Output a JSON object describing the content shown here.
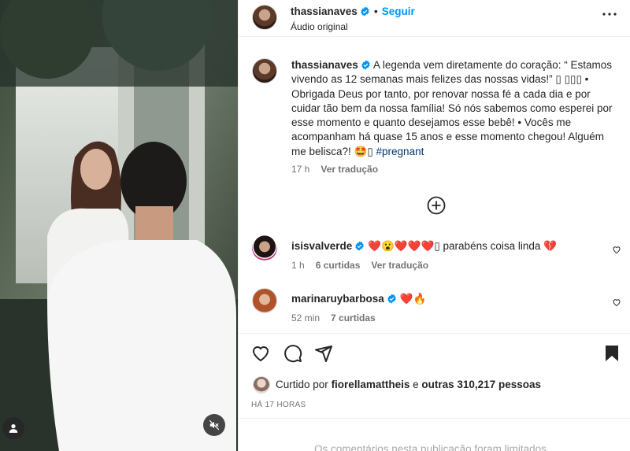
{
  "post": {
    "author": "thassianaves",
    "separator": "•",
    "follow_label": "Seguir",
    "audio_label": "Áudio original"
  },
  "caption": {
    "author": "thassianaves",
    "text_before_tag": "A legenda vem diretamente do coração: “ Estamos vivendo as 12 semanas mais felizes das nossas vidas!” ▯ ▯▯▯ • Obrigada Deus por tanto, por renovar nossa fé a cada dia e por cuidar tão bem da nossa família! Só nós sabemos como esperei por esse momento e quanto desejamos esse bebê! • Vocês me acompanham há quase 15 anos e esse momento chegou! Alguém me belisca?! 🤩▯ ",
    "hashtag": "#pregnant",
    "time": "17 h",
    "translate_label": "Ver tradução"
  },
  "comments": [
    {
      "username": "isisvalverde",
      "text": "❤️😮❤️❤️❤️▯ parabéns coisa linda 💔",
      "time": "1 h",
      "likes": "6 curtidas",
      "translate_label": "Ver tradução"
    },
    {
      "username": "marinaruybarbosa",
      "text": "❤️🔥",
      "time": "52 min",
      "likes": "7 curtidas"
    }
  ],
  "liked_by": {
    "prefix": "Curtido por",
    "user": "fiorellamattheis",
    "conjunction": "e",
    "others": "outras 310,217 pessoas"
  },
  "timestamp": "HÁ 17 HORAS",
  "limited_notice": "Os comentários nesta publicação foram limitados",
  "icons": {
    "verified": "verified-badge-icon",
    "more": "more-options-icon",
    "add_comment": "plus-circle-icon",
    "like": "heart-icon",
    "comment": "comment-icon",
    "share": "share-icon",
    "save": "bookmark-icon",
    "mute": "muted-speaker-icon",
    "tags": "user-tag-icon"
  },
  "colors": {
    "accent": "#0095f6",
    "verified": "#0095f6",
    "hashtag": "#00376b",
    "secondary_text": "#737373"
  }
}
